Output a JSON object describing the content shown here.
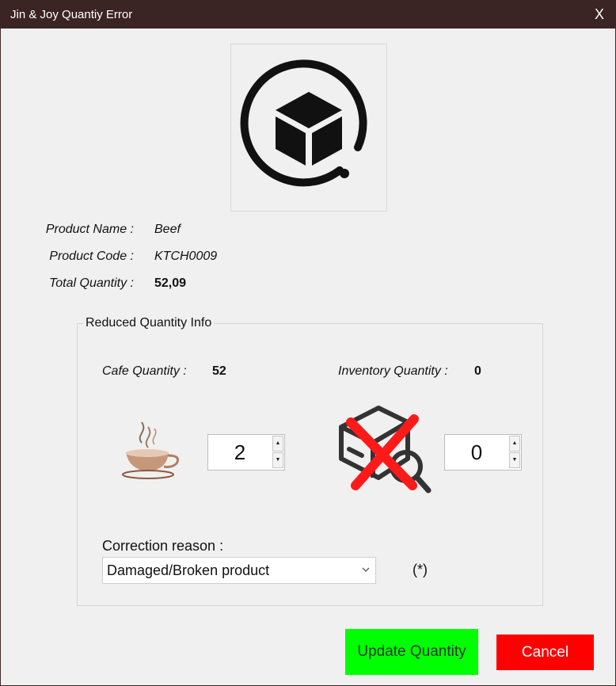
{
  "window": {
    "title": "Jin & Joy Quantiy Error",
    "close_label": "X"
  },
  "icons": {
    "logo": "package-box-icon",
    "cafe": "coffee-cup-icon",
    "inventory": "inventory-box-search-crossed-icon"
  },
  "product": {
    "name_label": "Product Name :",
    "name_value": "Beef",
    "code_label": "Product Code :",
    "code_value": "KTCH0009",
    "total_label": "Total Quantity :",
    "total_value": "52,09"
  },
  "reduced": {
    "legend": "Reduced Quantity Info",
    "cafe_label": "Cafe Quantity :",
    "cafe_value": "52",
    "inventory_label": "Inventory Quantity :",
    "inventory_value": "0",
    "cafe_spinner": "2",
    "inventory_spinner": "0",
    "spin_up": "▲",
    "spin_down": "▼"
  },
  "reason": {
    "label": "Correction reason :",
    "selected": "Damaged/Broken product",
    "required_marker": "(*)"
  },
  "buttons": {
    "update": "Update Quantity",
    "cancel": "Cancel"
  },
  "colors": {
    "titlebar": "#3b2424",
    "update_button": "#00ff00",
    "cancel_button": "#ff0000",
    "cross_mark": "#ff0000"
  }
}
